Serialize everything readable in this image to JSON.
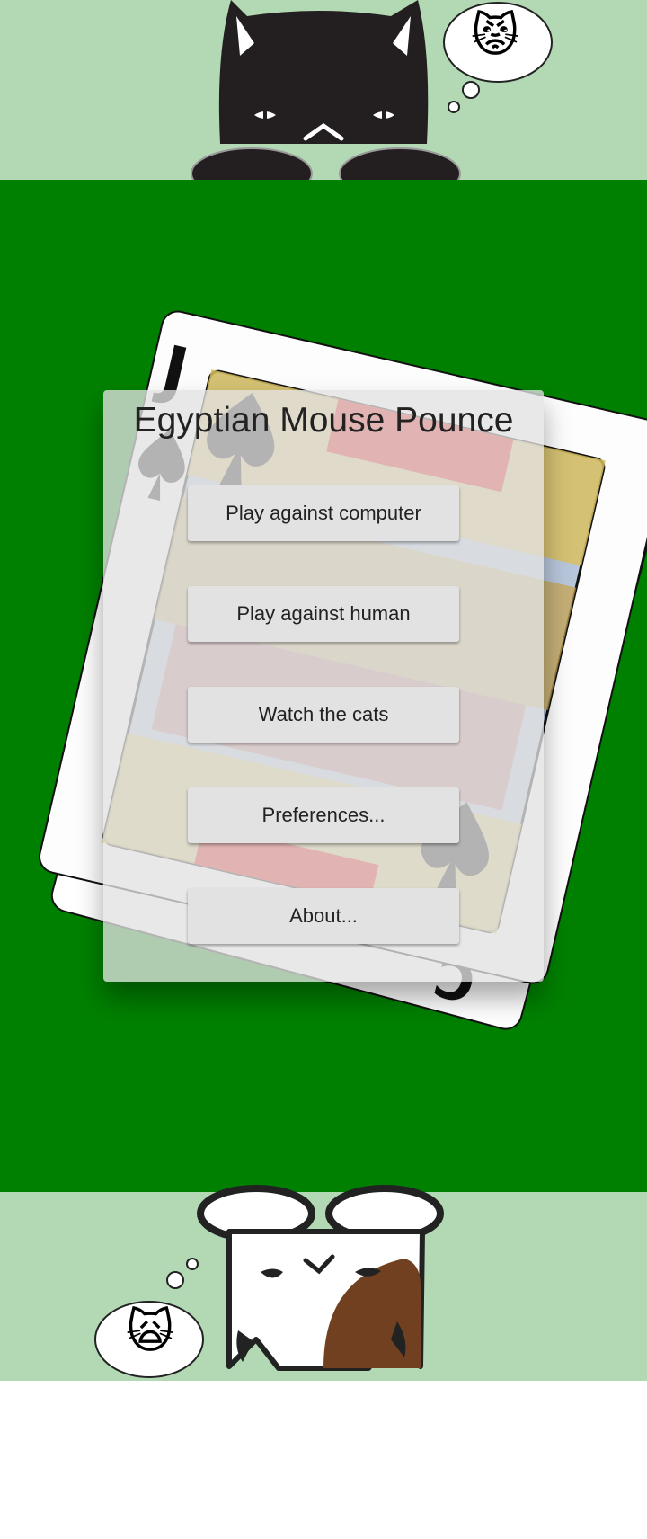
{
  "app": {
    "title": "Egyptian Mouse Pounce"
  },
  "menu": {
    "buttons": [
      {
        "id": "play-computer",
        "label": "Play against computer"
      },
      {
        "id": "play-human",
        "label": "Play against human"
      },
      {
        "id": "watch-cats",
        "label": "Watch the cats"
      },
      {
        "id": "preferences",
        "label": "Preferences..."
      },
      {
        "id": "about",
        "label": "About..."
      }
    ]
  },
  "cards": {
    "top_card_rank": "J",
    "top_card_suit": "spade",
    "bottom_card_rank_partial": "C"
  },
  "cats": {
    "top": {
      "name": "black-cat",
      "thought_emoji": "😾"
    },
    "bottom": {
      "name": "white-brown-cat",
      "thought_emoji": "🙀"
    }
  },
  "colors": {
    "table": "#008000",
    "band": "#b3d9b4",
    "panel": "#e1e1e1",
    "button": "#e2e2e2"
  }
}
